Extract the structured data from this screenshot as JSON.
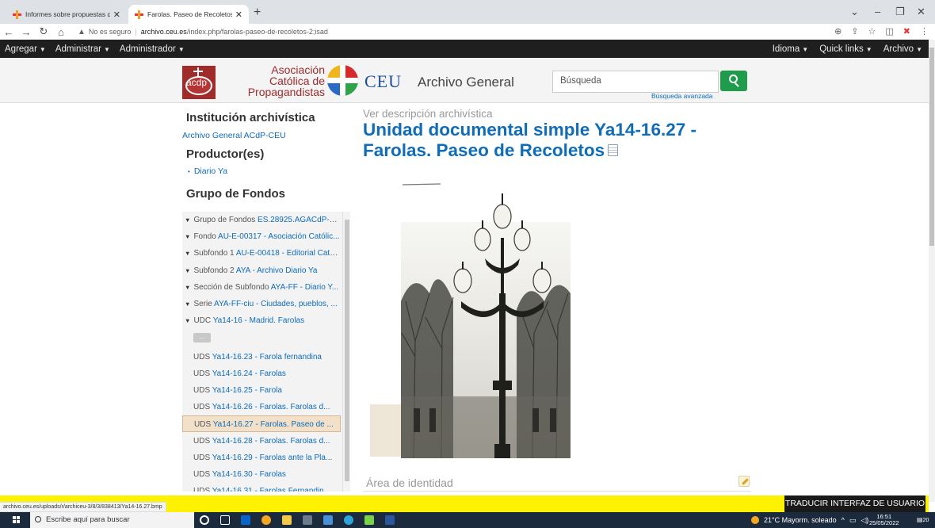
{
  "browser": {
    "tabs": [
      {
        "title": "Informes sobre propuestas de co",
        "active": false
      },
      {
        "title": "Farolas. Paseo de Recoletos - CE",
        "active": true
      }
    ],
    "address": {
      "security": "No es seguro",
      "host": "archivo.ceu.es",
      "path": "/index.php/farolas-paseo-de-recoletos-2;isad"
    },
    "status_url": "archivo.ceu.es/uploads/r/archiceu-3/8/3/838413/Ya14-16.27.bmp"
  },
  "adminbar": {
    "left": [
      "Agregar",
      "Administrar",
      "Administrador"
    ],
    "right": [
      "Idioma",
      "Quick links",
      "Archivo"
    ]
  },
  "header": {
    "association": [
      "Asociación",
      "Católica de",
      "Propagandistas"
    ],
    "logo_text": "acdp",
    "ceu": "CEU",
    "site_title": "Archivo General",
    "search_placeholder": "Búsqueda",
    "advanced_search": "Búsqueda avanzada"
  },
  "sidebar": {
    "institution_heading": "Institución archivística",
    "institution_link": "Archivo General ACdP-CEU",
    "producers_heading": "Productor(es)",
    "producers": [
      "Diario Ya"
    ],
    "fonds_heading": "Grupo de Fondos",
    "tree": [
      {
        "prefix": "Grupo de Fondos ",
        "link": "ES.28925.AGACdP-C..."
      },
      {
        "prefix": "Fondo ",
        "link": "AU-E-00317 - Asociación Católic..."
      },
      {
        "prefix": "Subfondo 1 ",
        "link": "AU-E-00418 - Editorial Cató..."
      },
      {
        "prefix": "Subfondo 2 ",
        "link": "AYA - Archivo Diario Ya"
      },
      {
        "prefix": "Sección de Subfondo ",
        "link": "AYA-FF - Diario Y..."
      },
      {
        "prefix": "Serie ",
        "link": "AYA-FF-ciu - Ciudades, pueblos, ..."
      },
      {
        "prefix": "UDC ",
        "link": "Ya14-16 - Madrid. Farolas"
      }
    ],
    "more_label": "...",
    "children": [
      {
        "prefix": "UDS ",
        "link": "Ya14-16.23 - Farola fernandina"
      },
      {
        "prefix": "UDS ",
        "link": "Ya14-16.24 - Farolas"
      },
      {
        "prefix": "UDS ",
        "link": "Ya14-16.25 - Farola"
      },
      {
        "prefix": "UDS ",
        "link": "Ya14-16.26 - Farolas. Farolas d..."
      },
      {
        "prefix": "UDS ",
        "link": "Ya14-16.27 - Farolas. Paseo de ...",
        "active": true
      },
      {
        "prefix": "UDS ",
        "link": "Ya14-16.28 - Farolas. Farolas d..."
      },
      {
        "prefix": "UDS ",
        "link": "Ya14-16.29 - Farolas ante la Pla..."
      },
      {
        "prefix": "UDS ",
        "link": "Ya14-16.30 - Farolas"
      },
      {
        "prefix": "UDS ",
        "link": "Ya14-16.31 - Farolas Fernandin..."
      }
    ]
  },
  "main": {
    "kicker": "Ver descripción archivística",
    "title_line1": "Unidad documental simple Ya14-16.27 -",
    "title_line2": "Farolas. Paseo de Recoletos",
    "identity_area": "Área de identidad"
  },
  "translate_button": "TRADUCIR INTERFAZ DE USUARIO",
  "taskbar": {
    "search_placeholder": "Escribe aquí para buscar",
    "weather": "21°C  Mayorm. soleado",
    "time": "16:51",
    "date": "25/05/2022",
    "notifications": "20"
  }
}
